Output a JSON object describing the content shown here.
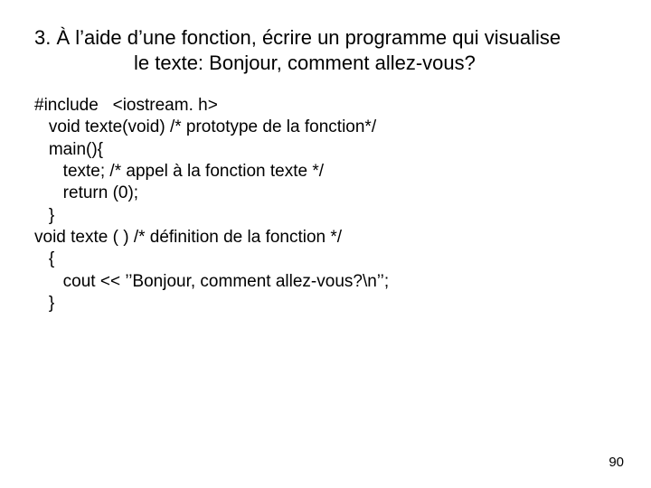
{
  "title": {
    "line1": "3. À l’aide d’une fonction, écrire un programme qui visualise",
    "line2": "le texte: Bonjour, comment allez-vous?"
  },
  "code": {
    "l1": "#include   <iostream. h>",
    "l2": "   void texte(void) /* prototype de la fonction*/",
    "l3": "   main(){",
    "l4": "      texte; /* appel à la fonction texte */",
    "l5": "      return (0);",
    "l6": "   }",
    "l7": "void texte ( ) /* définition de la fonction */",
    "l8": "   {",
    "l9": "      cout << ’’Bonjour, comment allez-vous?\\n’’;",
    "l10": "   }"
  },
  "page_number": "90"
}
